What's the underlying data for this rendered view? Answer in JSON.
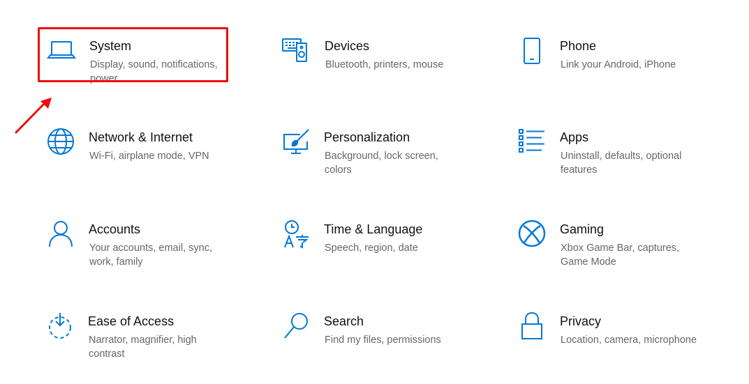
{
  "tiles": [
    {
      "icon": "laptop-icon",
      "title": "System",
      "description": "Display, sound, notifications, power"
    },
    {
      "icon": "devices-icon",
      "title": "Devices",
      "description": "Bluetooth, printers, mouse"
    },
    {
      "icon": "phone-icon",
      "title": "Phone",
      "description": "Link your Android, iPhone"
    },
    {
      "icon": "globe-icon",
      "title": "Network & Internet",
      "description": "Wi-Fi, airplane mode, VPN"
    },
    {
      "icon": "paintbrush-icon",
      "title": "Personalization",
      "description": "Background, lock screen, colors"
    },
    {
      "icon": "apps-list-icon",
      "title": "Apps",
      "description": "Uninstall, defaults, optional features"
    },
    {
      "icon": "person-icon",
      "title": "Accounts",
      "description": "Your accounts, email, sync, work, family"
    },
    {
      "icon": "time-language-icon",
      "title": "Time & Language",
      "description": "Speech, region, date"
    },
    {
      "icon": "xbox-icon",
      "title": "Gaming",
      "description": "Xbox Game Bar, captures, Game Mode"
    },
    {
      "icon": "ease-of-access-icon",
      "title": "Ease of Access",
      "description": "Narrator, magnifier, high contrast"
    },
    {
      "icon": "search-icon",
      "title": "Search",
      "description": "Find my files, permissions"
    },
    {
      "icon": "padlock-icon",
      "title": "Privacy",
      "description": "Location, camera, microphone"
    }
  ],
  "colors": {
    "accent": "#0078d7",
    "title_text": "#111111",
    "description_text": "#666666",
    "annotation": "#ee0c0c"
  }
}
